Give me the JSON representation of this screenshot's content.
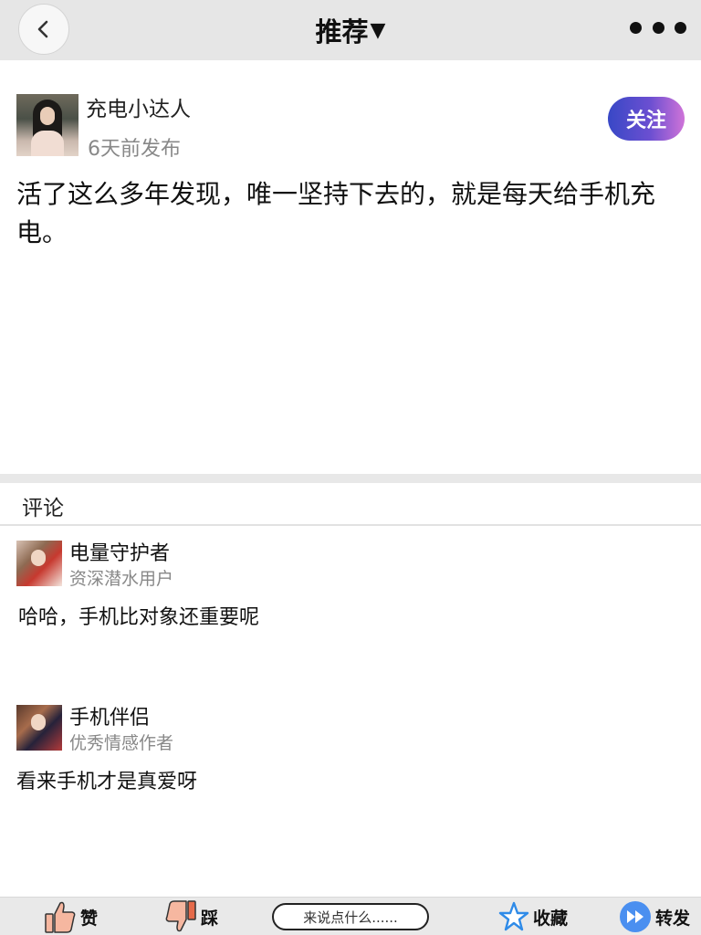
{
  "header": {
    "title": "推荐",
    "title_caret": "▼"
  },
  "post": {
    "author": "充电小达人",
    "time": "6天前发布",
    "follow_label": "关注",
    "content": "活了这么多年发现，唯一坚持下去的，就是每天给手机充电。"
  },
  "comments_section": {
    "title": "评论",
    "items": [
      {
        "name": "电量守护者",
        "badge": "资深潜水用户",
        "text": "哈哈，手机比对象还重要呢"
      },
      {
        "name": "手机伴侣",
        "badge": "优秀情感作者",
        "text": "看来手机才是真爱呀"
      }
    ]
  },
  "bottom_bar": {
    "like_label": "赞",
    "dislike_label": "踩",
    "comment_placeholder": "来说点什么......",
    "favorite_label": "收藏",
    "share_label": "转发"
  },
  "colors": {
    "header_bg": "#e6e6e6",
    "follow_gradient_start": "#3848c6",
    "follow_gradient_end": "#cf73d8",
    "star_blue": "#2f8be8",
    "share_blue": "#4a8ff0",
    "like_skin": "#f6b7a0"
  },
  "icons": {
    "back": "chevron-left-icon",
    "more": "more-dots-icon",
    "like": "thumbs-up-icon",
    "dislike": "thumbs-down-icon",
    "favorite": "star-icon",
    "share": "fast-forward-icon"
  }
}
